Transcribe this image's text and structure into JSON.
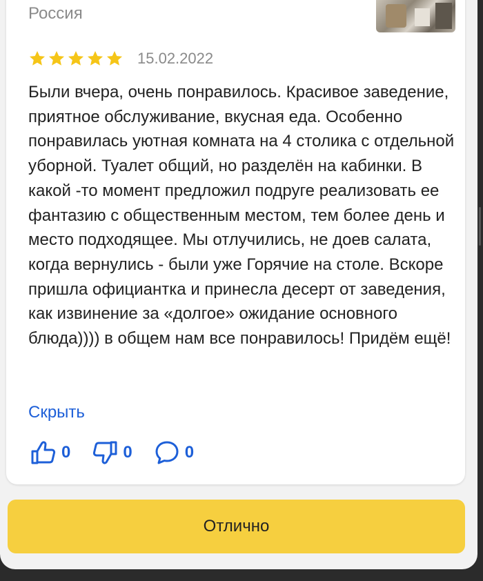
{
  "review": {
    "country": "Россия",
    "rating": 5,
    "rating_max": 5,
    "date": "15.02.2022",
    "text": "Были вчера, очень понравилось. Красивое заведение, приятное обслуживание, вкусная еда. Особенно понравилась уютная комната на 4 столика с отдельной уборной. Туалет общий, но разделён на кабинки. В какой -то момент предложил подруге реализовать ее фантазию с общественным местом, тем более день и место подходящее. Мы отлучились, не доев салата, когда вернулись - были уже Горячие на столе. Вскоре пришла официантка и принесла десерт от заведения, как извинение за «долгое» ожидание основного блюда)))) в общем нам все понравилось! Придём ещё!",
    "collapse_label": "Скрыть",
    "likes": "0",
    "dislikes": "0",
    "comments": "0"
  },
  "action_button_label": "Отлично",
  "colors": {
    "star": "#f5c518",
    "link": "#1d5fd8",
    "button": "#f6cf3f"
  },
  "icons": [
    "star-icon",
    "thumbs-up-icon",
    "thumbs-down-icon",
    "comment-icon"
  ]
}
